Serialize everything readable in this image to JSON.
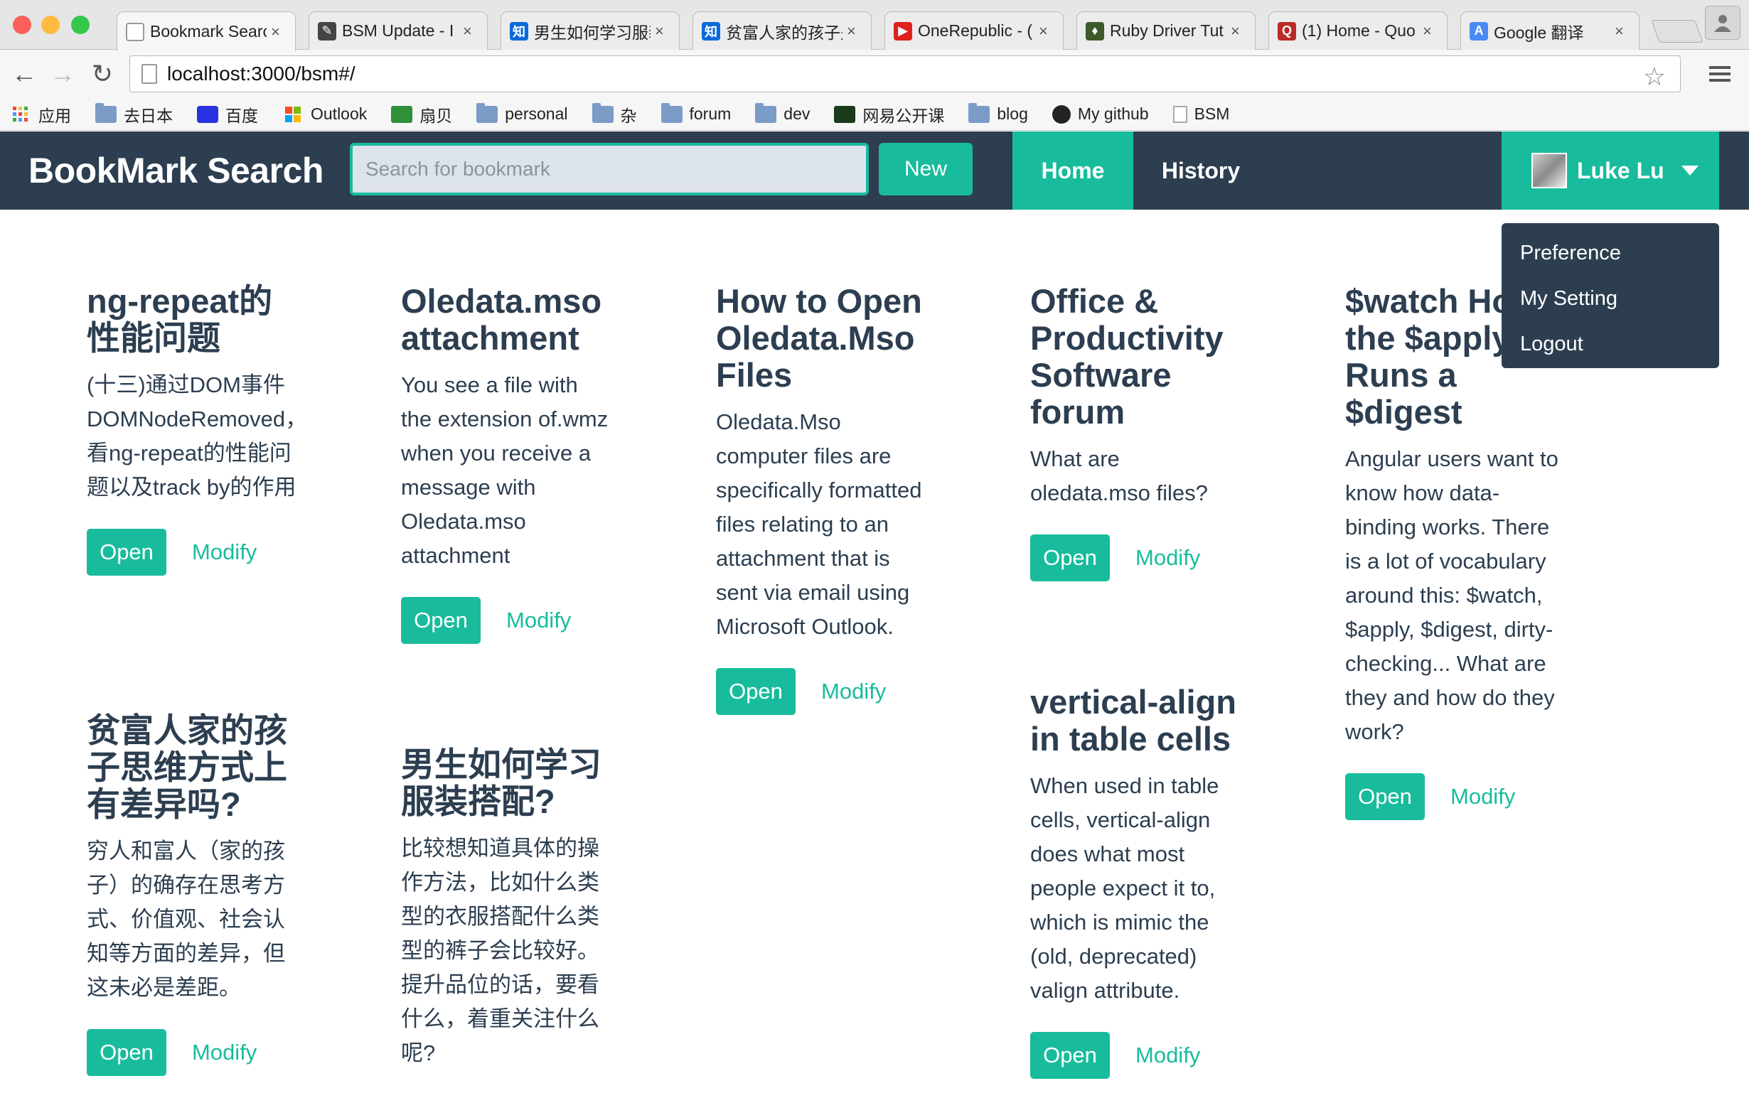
{
  "browser": {
    "tabs": [
      {
        "title": "Bookmark Search",
        "fav_color": "#ffffff",
        "fav_text": ""
      },
      {
        "title": "BSM Update - I",
        "fav_color": "#444444",
        "fav_text": "✎"
      },
      {
        "title": "男生如何学习服装",
        "fav_color": "#0b6ad8",
        "fav_text": "知"
      },
      {
        "title": "贫富人家的孩子是",
        "fav_color": "#0b6ad8",
        "fav_text": "知"
      },
      {
        "title": "OneRepublic - (",
        "fav_color": "#e0201b",
        "fav_text": "▶"
      },
      {
        "title": "Ruby Driver Tut",
        "fav_color": "#3d5a2a",
        "fav_text": "♦"
      },
      {
        "title": "(1) Home - Quo",
        "fav_color": "#b92b27",
        "fav_text": "Q"
      },
      {
        "title": "Google 翻译",
        "fav_color": "#4a8af4",
        "fav_text": "A"
      }
    ],
    "tab_close": "×",
    "back": "←",
    "forward": "→",
    "reload": "↻",
    "url": "localhost:3000/bsm#/",
    "star": "☆",
    "bookmarks": [
      {
        "label": "应用",
        "icon": "apps-icon"
      },
      {
        "label": "去日本",
        "icon": "folder-icon"
      },
      {
        "label": "百度",
        "icon": "baidu-icon"
      },
      {
        "label": "Outlook",
        "icon": "windows-icon"
      },
      {
        "label": "扇贝",
        "icon": "shanbay-icon"
      },
      {
        "label": "personal",
        "icon": "folder-icon"
      },
      {
        "label": "杂",
        "icon": "folder-icon"
      },
      {
        "label": "forum",
        "icon": "folder-icon"
      },
      {
        "label": "dev",
        "icon": "folder-icon"
      },
      {
        "label": "网易公开课",
        "icon": "netease-icon"
      },
      {
        "label": "blog",
        "icon": "folder-icon"
      },
      {
        "label": "My github",
        "icon": "github-icon"
      },
      {
        "label": "BSM",
        "icon": "page-icon"
      }
    ]
  },
  "app": {
    "brand": "BookMark Search",
    "search_placeholder": "Search for bookmark",
    "new_label": "New",
    "nav": {
      "home": "Home",
      "history": "History"
    },
    "user": {
      "name": "Luke Lu"
    },
    "dropdown": [
      "Preference",
      "My Setting",
      "Logout"
    ],
    "open_label": "Open",
    "modify_label": "Modify"
  },
  "cards": [
    {
      "title": "ng-repeat的性能问题",
      "desc": "(十三)通过DOM事件DOMNodeRemoved，看ng-repeat的性能问题以及track by的作用"
    },
    {
      "title": "Oledata.mso attachment",
      "desc": "You see a file with the extension of.wmz when you receive a message with Oledata.mso attachment"
    },
    {
      "title": "How to Open Oledata.Mso Files",
      "desc": "Oledata.Mso computer files are specifically formatted files relating to an attachment that is sent via email using Microsoft Outlook."
    },
    {
      "title": "Office & Productivity Software forum",
      "desc": "What are oledata.mso files?"
    },
    {
      "title": "$watch How the $apply Runs a $digest",
      "desc": "Angular users want to know how data-binding works. There is a lot of vocabulary around this: $watch, $apply, $digest, dirty-checking... What are they and how do they work?"
    },
    {
      "title": "贫富人家的孩子思维方式上有差异吗?",
      "desc": "穷人和富人（家的孩子）的确存在思考方式、价值观、社会认知等方面的差异，但这未必是差距。"
    },
    {
      "title": "男生如何学习服装搭配?",
      "desc": "比较想知道具体的操作方法，比如什么类型的衣服搭配什么类型的裤子会比较好。提升品位的话，要看什么，着重关注什么呢?"
    },
    {
      "title": "vertical-align in table cells",
      "desc": "When used in table cells, vertical-align does what most people expect it to, which is mimic the (old, deprecated) valign attribute."
    }
  ]
}
